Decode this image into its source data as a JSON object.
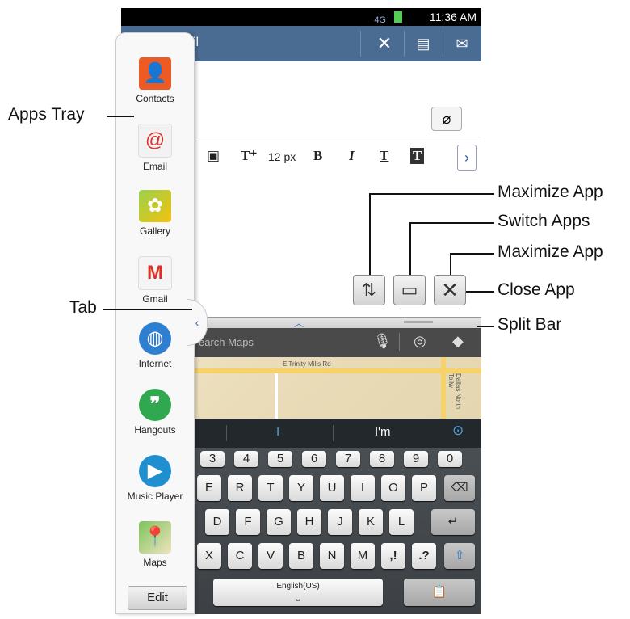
{
  "status_bar": {
    "time": "11:36 AM",
    "network": "4G"
  },
  "email": {
    "title": "ail",
    "toolbar": {
      "font_size": "12 px",
      "bold": "B",
      "italic": "I",
      "underline": "T",
      "text_size": "T⁺"
    }
  },
  "maps": {
    "search_placeholder": "earch Maps",
    "street_label": "E Trinity Mills Rd",
    "road_label": "Dallas North Tollw"
  },
  "suggestions": {
    "middle": "I",
    "right": "I'm"
  },
  "keyboard": {
    "numbers": [
      "3",
      "4",
      "5",
      "6",
      "7",
      "8",
      "9",
      "0"
    ],
    "row1": [
      "E",
      "R",
      "T",
      "Y",
      "U",
      "I",
      "O",
      "P"
    ],
    "row2": [
      "D",
      "F",
      "G",
      "H",
      "J",
      "K",
      "L"
    ],
    "row3": [
      "X",
      "C",
      "V",
      "B",
      "N",
      "M",
      ",!",
      ".?"
    ],
    "space": "English(US)"
  },
  "apps_tray": {
    "items": [
      {
        "label": "Contacts",
        "icon": "contacts-icon"
      },
      {
        "label": "Email",
        "icon": "email-icon"
      },
      {
        "label": "Gallery",
        "icon": "gallery-icon"
      },
      {
        "label": "Gmail",
        "icon": "gmail-icon"
      },
      {
        "label": "Internet",
        "icon": "internet-icon"
      },
      {
        "label": "Hangouts",
        "icon": "hangouts-icon"
      },
      {
        "label": "Music Player",
        "icon": "music-player-icon"
      },
      {
        "label": "Maps",
        "icon": "maps-icon"
      }
    ],
    "edit_label": "Edit"
  },
  "callouts": {
    "apps_tray": "Apps Tray",
    "tab": "Tab",
    "maximize_top": "Maximize App",
    "switch_apps": "Switch Apps",
    "maximize_bottom": "Maximize App",
    "close_app": "Close App",
    "split_bar": "Split Bar"
  }
}
